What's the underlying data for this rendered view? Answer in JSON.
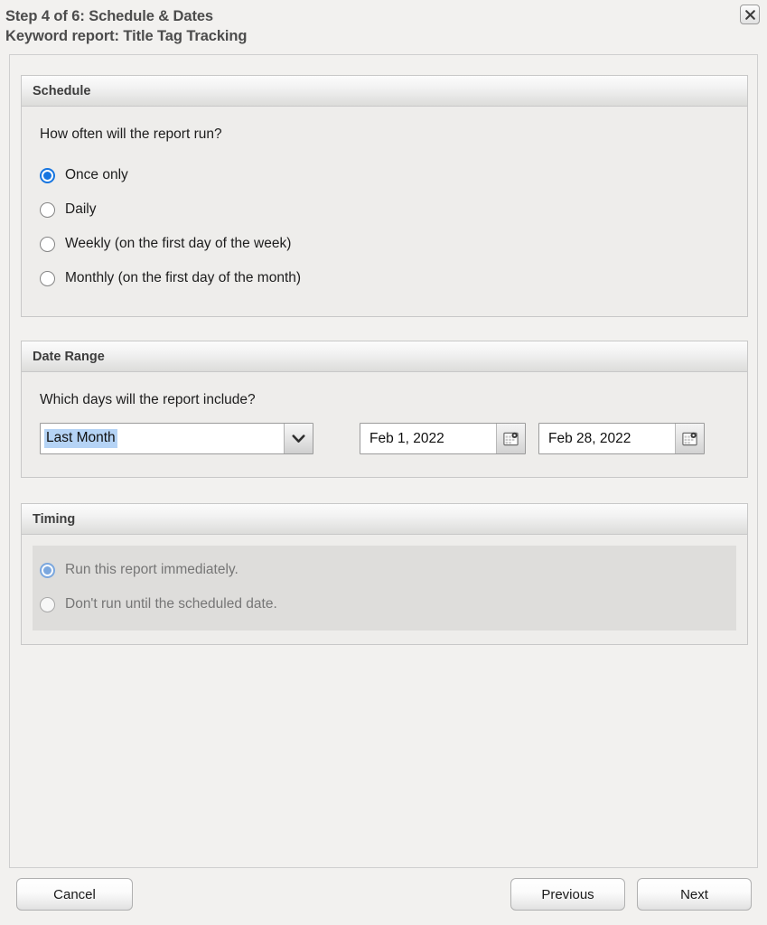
{
  "header": {
    "step_line": "Step 4 of 6: Schedule & Dates",
    "report_line": "Keyword report: Title Tag Tracking",
    "close_icon": "close-icon"
  },
  "sections": {
    "schedule": {
      "title": "Schedule",
      "question": "How often will the report run?",
      "options": [
        {
          "label": "Once only",
          "selected": true
        },
        {
          "label": "Daily",
          "selected": false
        },
        {
          "label": "Weekly (on the first day of the week)",
          "selected": false
        },
        {
          "label": "Monthly (on the first day of the month)",
          "selected": false
        }
      ]
    },
    "date_range": {
      "title": "Date Range",
      "question": "Which days will the report include?",
      "preset_select": {
        "value": "Last Month",
        "arrow_icon": "chevron-down-icon"
      },
      "start_date": {
        "value": "Feb 1, 2022",
        "calendar_icon": "calendar-icon"
      },
      "end_date": {
        "value": "Feb 28, 2022",
        "calendar_icon": "calendar-icon"
      }
    },
    "timing": {
      "title": "Timing",
      "disabled": true,
      "options": [
        {
          "label": "Run this report immediately.",
          "selected": true
        },
        {
          "label": "Don't run until the scheduled date.",
          "selected": false
        }
      ]
    }
  },
  "footer": {
    "cancel_label": "Cancel",
    "previous_label": "Previous",
    "next_label": "Next"
  },
  "colors": {
    "accent_blue": "#1675e0",
    "accent_blue_disabled": "#7ba7de",
    "selection_highlight": "#b5d3f5",
    "page_background": "#f2f1ef",
    "title_text": "#4c4c4c",
    "disabled_text": "#767676",
    "disabled_panel": "#dedddb"
  }
}
